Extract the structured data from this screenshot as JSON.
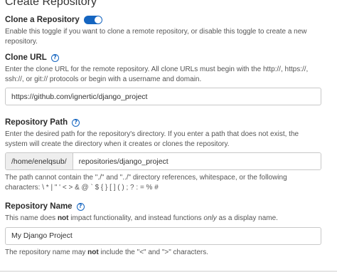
{
  "page": {
    "title": "Create Repository"
  },
  "clone_toggle": {
    "label": "Clone a Repository",
    "state": "on",
    "description": "Enable this toggle if you want to clone a remote repository, or disable this toggle to create a new repository."
  },
  "clone_url": {
    "label": "Clone URL",
    "description": "Enter the clone URL for the remote repository. All clone URLs must begin with the http://, https://, ssh://, or git:// protocols or begin with a username and domain.",
    "value": "https://github.com/ignertic/django_project"
  },
  "repository_path": {
    "label": "Repository Path",
    "description": "Enter the desired path for the repository's directory. If you enter a path that does not exist, the system will create the directory when it creates or clones the repository.",
    "prefix": "/home/enelqsub/",
    "value": "repositories/django_project",
    "note": "The path cannot contain the \"./\" and \"../\" directory references, whitespace, or the following characters: \\ * | \" ' < > & @ ` $ { } [ ] ( ) ; ? : = % #"
  },
  "repository_name": {
    "label": "Repository Name",
    "desc_part1": "This name does ",
    "desc_bold": "not",
    "desc_part2": " impact functionality, and instead functions ",
    "desc_italic": "only",
    "desc_part3": " as a display name.",
    "value": "My Django Project",
    "note_part1": "The repository name may ",
    "note_bold": "not",
    "note_part2": " include the \"<\" and \">\" characters."
  },
  "colors": {
    "accent": "#1565c0"
  },
  "icons": {
    "help": "question-circle-icon"
  }
}
